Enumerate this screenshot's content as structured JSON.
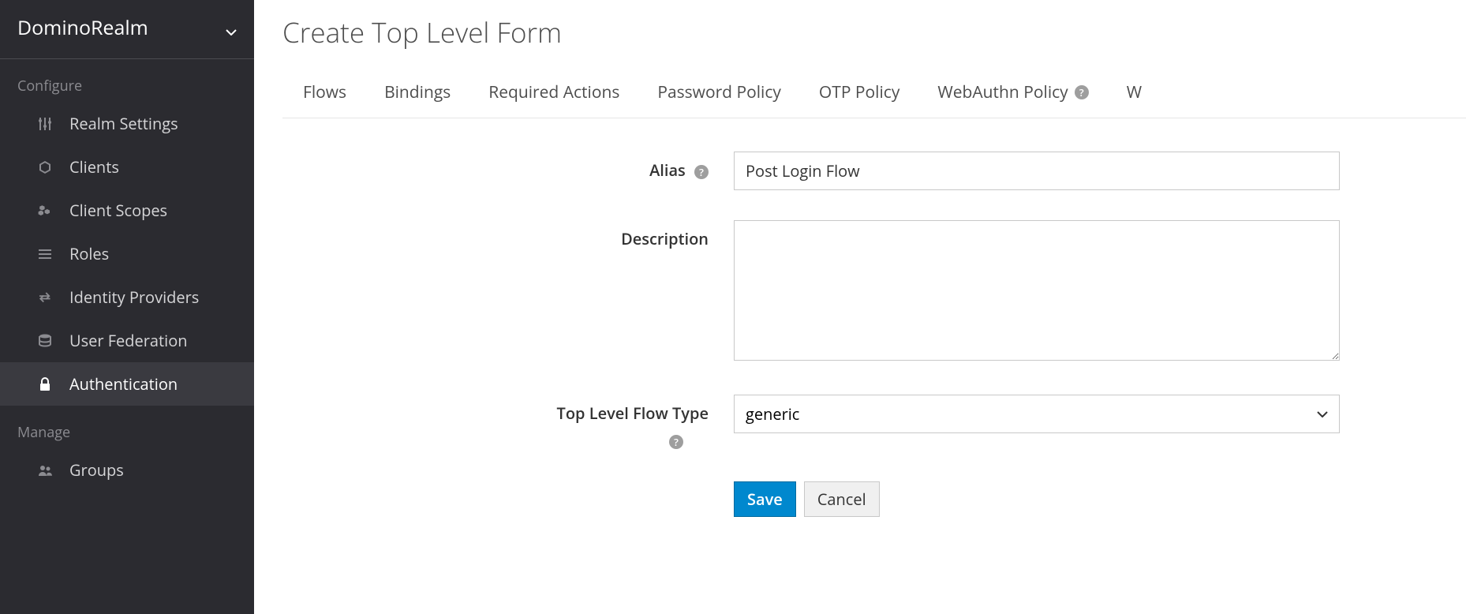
{
  "realm": {
    "name": "DominoRealm"
  },
  "sidebar": {
    "sections": [
      {
        "header": "Configure",
        "items": [
          {
            "label": "Realm Settings",
            "icon": "sliders-icon"
          },
          {
            "label": "Clients",
            "icon": "cube-icon"
          },
          {
            "label": "Client Scopes",
            "icon": "cubes-icon"
          },
          {
            "label": "Roles",
            "icon": "list-icon"
          },
          {
            "label": "Identity Providers",
            "icon": "exchange-icon"
          },
          {
            "label": "User Federation",
            "icon": "database-icon"
          },
          {
            "label": "Authentication",
            "icon": "lock-icon",
            "active": true
          }
        ]
      },
      {
        "header": "Manage",
        "items": [
          {
            "label": "Groups",
            "icon": "users-icon"
          }
        ]
      }
    ]
  },
  "page": {
    "title": "Create Top Level Form"
  },
  "tabs": [
    {
      "label": "Flows"
    },
    {
      "label": "Bindings"
    },
    {
      "label": "Required Actions"
    },
    {
      "label": "Password Policy"
    },
    {
      "label": "OTP Policy"
    },
    {
      "label": "WebAuthn Policy",
      "help": true
    },
    {
      "label": "W"
    }
  ],
  "form": {
    "alias": {
      "label": "Alias",
      "value": "Post Login Flow"
    },
    "description": {
      "label": "Description",
      "value": ""
    },
    "flowType": {
      "label": "Top Level Flow Type",
      "value": "generic",
      "options": [
        "generic"
      ]
    },
    "save": "Save",
    "cancel": "Cancel"
  }
}
